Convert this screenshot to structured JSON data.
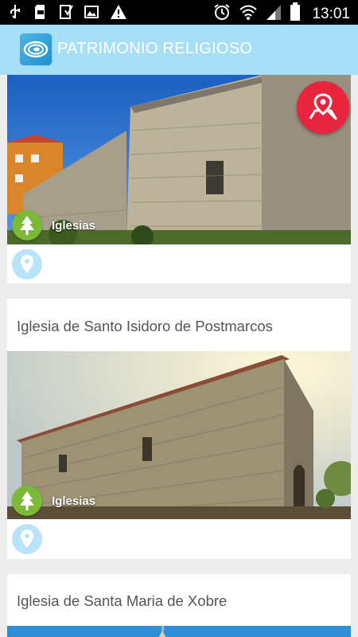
{
  "status_bar": {
    "time": "13:01",
    "icons": [
      "usb-icon",
      "sd-card-icon",
      "download-icon",
      "image-icon",
      "warning-icon",
      "alarm-icon",
      "wifi-icon",
      "signal-icon",
      "battery-icon"
    ]
  },
  "app_bar": {
    "title": "PATRIMONIO RELIGIOSO",
    "logo_icon": "spiral-logo-icon"
  },
  "fab": {
    "icon": "map-pin-icon",
    "color": "#e9253d"
  },
  "colors": {
    "category_green": "#7cb936",
    "pin_blue": "#b9e3f8",
    "appbar": "#a7dff6"
  },
  "cards": [
    {
      "title": "",
      "category": "Iglesias",
      "category_icon": "tree-icon",
      "location_icon": "location-pin-icon"
    },
    {
      "title": "Iglesia de Santo Isidoro de Postmarcos",
      "category": "Iglesias",
      "category_icon": "tree-icon",
      "location_icon": "location-pin-icon"
    },
    {
      "title": "Iglesia de Santa Maria de Xobre"
    }
  ]
}
